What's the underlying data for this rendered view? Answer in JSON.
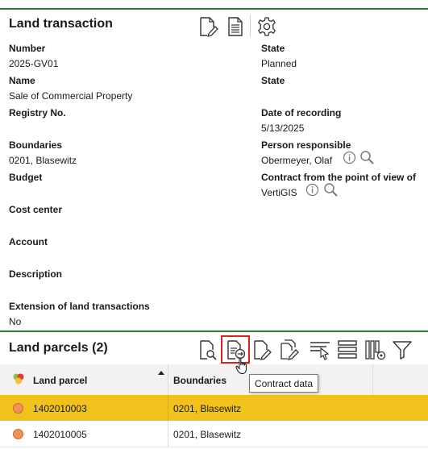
{
  "land_transaction": {
    "title": "Land transaction",
    "fields": {
      "number_label": "Number",
      "number_value": "2025-GV01",
      "state_label": "State",
      "state_value": "Planned",
      "name_label": "Name",
      "name_value": "Sale of Commercial Property",
      "state2_label": "State",
      "registry_label": "Registry No.",
      "date_label": "Date of recording",
      "date_value": "5/13/2025",
      "boundaries_label": "Boundaries",
      "boundaries_value": "0201, Blasewitz",
      "person_label": "Person responsible",
      "person_value": "Obermeyer, Olaf",
      "budget_label": "Budget",
      "contract_pov_label": "Contract from the point of view of",
      "contract_pov_value": "VertiGIS",
      "cost_center_label": "Cost center",
      "account_label": "Account",
      "description_label": "Description",
      "extension_label": "Extension of land transactions",
      "extension_value": "No"
    }
  },
  "land_parcels": {
    "title": "Land parcels (2)",
    "tooltip": "Contract data",
    "columns": [
      "Land parcel",
      "Boundaries"
    ],
    "rows": [
      {
        "land_parcel": "1402010003",
        "boundaries": "0201, Blasewitz",
        "selected": true
      },
      {
        "land_parcel": "1402010005",
        "boundaries": "0201, Blasewitz",
        "selected": false
      }
    ]
  },
  "colors": {
    "accent_green": "#2e7d32",
    "selected_row": "#f1c21b",
    "highlight_red": "#e02020",
    "parcel_dot": "#f0915a"
  },
  "icons": [
    "edit-document-icon",
    "document-icon",
    "gear-icon",
    "info-icon",
    "search-icon",
    "preview-icon",
    "contract-data-icon",
    "edit-icon",
    "copy-edit-icon",
    "select-icon",
    "list-icon",
    "column-settings-icon",
    "filter-icon",
    "layers-icon",
    "sort-asc-icon",
    "pointer-cursor-icon"
  ]
}
